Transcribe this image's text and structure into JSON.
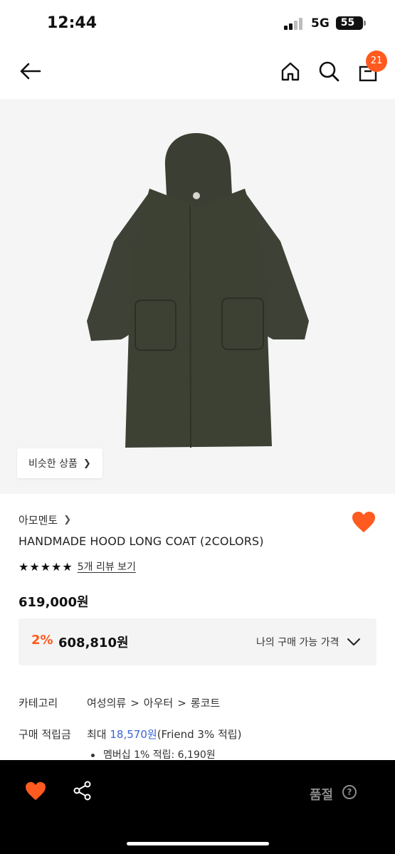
{
  "status_bar": {
    "time": "12:44",
    "network": "5G",
    "battery": "55"
  },
  "header": {
    "cart_count": "21"
  },
  "similar_button": {
    "label": "비슷한 상품"
  },
  "product": {
    "brand": "아모멘토",
    "name": "HANDMADE HOOD LONG COAT (2COLORS)",
    "stars": "★★★★★",
    "review_link": "5개 리뷰 보기",
    "price": "619,000원",
    "rating": 5
  },
  "benefit": {
    "discount_rate": "2%",
    "discount_price": "608,810원",
    "label": "나의 구매 가능 가격"
  },
  "category": {
    "label": "카테고리",
    "path": [
      "여성의류",
      "아우터",
      "롱코트"
    ]
  },
  "points": {
    "label": "구매 적립금",
    "prefix": "최대",
    "amount": "18,570원",
    "suffix": "(Friend 3% 적립)",
    "membership": "멤버십 1% 적립: 6,190원"
  },
  "bottom_bar": {
    "status": "품절",
    "help": "?"
  },
  "colors": {
    "accent": "#ff5a1f",
    "points_blue": "#3a64d8",
    "coat": "#3d4134"
  }
}
